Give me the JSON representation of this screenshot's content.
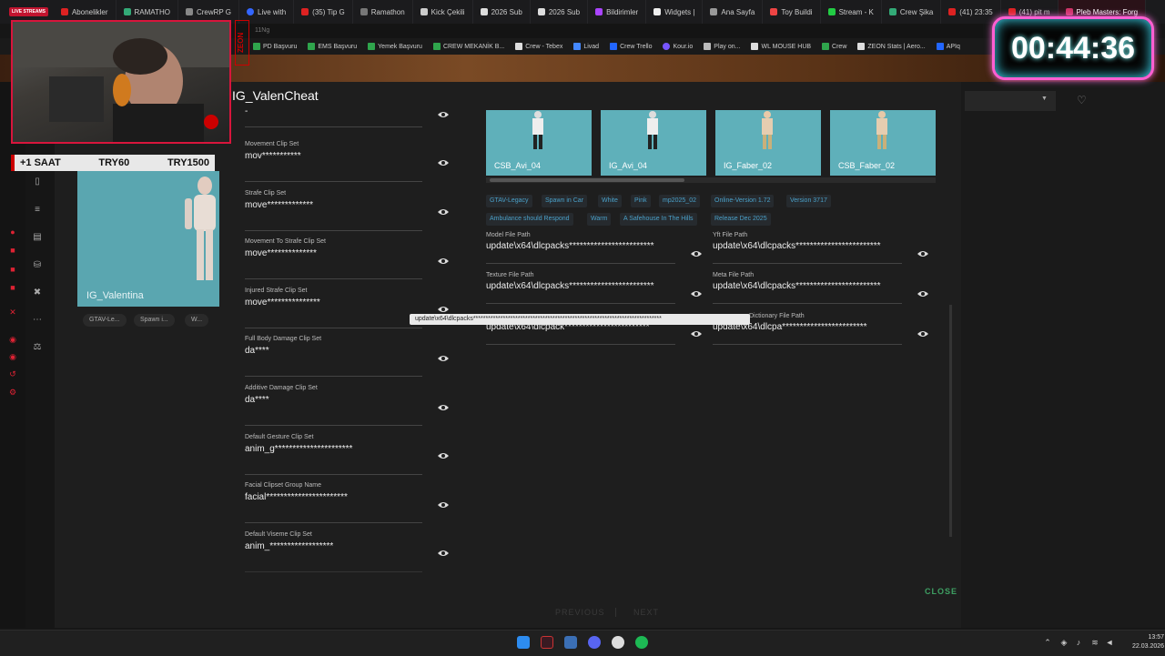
{
  "browser": {
    "tabs": [
      {
        "label": "Abonelikler"
      },
      {
        "label": "RAMATHO"
      },
      {
        "label": "CrewRP G"
      },
      {
        "label": "Live with"
      },
      {
        "label": "(35) Tip G"
      },
      {
        "label": "Ramathon"
      },
      {
        "label": "Kick Çekili"
      },
      {
        "label": "2026 Sub"
      },
      {
        "label": "2026 Sub"
      },
      {
        "label": "Bildirimler"
      },
      {
        "label": "Widgets |"
      },
      {
        "label": "Ana Sayfa"
      },
      {
        "label": "Toy Buildi"
      },
      {
        "label": "Stream - K"
      },
      {
        "label": "Crew Şika"
      },
      {
        "label": "(41) 23:35"
      },
      {
        "label": "(41) pit m"
      },
      {
        "label": "Pleb Masters: Forg"
      }
    ],
    "live_badge": "LIVE STREAMS",
    "url_fragment": "11Ng",
    "bookmarks": [
      "PD Başvuru",
      "EMS Başvuru",
      "Yemek Başvuru",
      "CREW MEKANİK B...",
      "Crew - Tebex",
      "Livad",
      "Crew Trello",
      "Kour.io",
      "Play on...",
      "WL MOUSE HUB",
      "Crew",
      "ZEON Stats | Aero...",
      "APIq"
    ]
  },
  "overlay": {
    "timer": "00:44:36",
    "ticker": {
      "a": "+1 SAAT",
      "b": "TRY60",
      "c": "TRY1500"
    },
    "zeon": "ZEON"
  },
  "character_card": {
    "name": "IG_Valentina",
    "chips": [
      "GTAV-Le...",
      "Spawn i...",
      "W..."
    ]
  },
  "detail": {
    "title": "IG_ValenCheat",
    "top_value": "-",
    "fields": [
      {
        "label": "Movement Clip Set",
        "value": "mov***********"
      },
      {
        "label": "Strafe Clip Set",
        "value": "move*************"
      },
      {
        "label": "Movement To Strafe Clip Set",
        "value": "move**************"
      },
      {
        "label": "Injured Strafe Clip Set",
        "value": "move***************"
      },
      {
        "label": "Full Body Damage Clip Set",
        "value": "da****"
      },
      {
        "label": "Additive Damage Clip Set",
        "value": "da****"
      },
      {
        "label": "Default Gesture Clip Set",
        "value": "anim_g**********************"
      },
      {
        "label": "Facial Clipset Group Name",
        "value": "facial***********************"
      },
      {
        "label": "Default Viseme Clip Set",
        "value": "anim_******************"
      }
    ],
    "thumbnails": [
      "CSB_Avi_04",
      "IG_Avi_04",
      "IG_Faber_02",
      "CSB_Faber_02"
    ],
    "tags": [
      "GTAV-Legacy",
      "Spawn in Car",
      "White",
      "Pink",
      "mp2025_02",
      "Online-Version 1.72",
      "Version 3717",
      "Ambulance should Respond",
      "Warm",
      "A Safehouse In The Hills",
      "Release Dec 2025"
    ],
    "paths": [
      {
        "label": "Model File Path",
        "value": "update\\x64\\dlcpacks************************"
      },
      {
        "label": "Yft File Path",
        "value": "update\\x64\\dlcpacks************************"
      },
      {
        "label": "Texture File Path",
        "value": "update\\x64\\dlcpacks************************"
      },
      {
        "label": "Meta File Path",
        "value": "update\\x64\\dlcpacks************************"
      },
      {
        "label": "",
        "value": "update\\x64\\dlcpack************************"
      },
      {
        "label": "Dictionary File Path",
        "value": "update\\x64\\dlcpa************************"
      }
    ],
    "tooltip": "update\\x64\\dlcpacks****************************************************************************",
    "close_label": "CLOSE",
    "prev_label": "PREVIOUS",
    "next_label": "NEXT"
  },
  "taskbar": {
    "time": "13:57",
    "date": "22.03.2026"
  },
  "colors": {
    "accent": "#3ea063",
    "tag_text": "#4aa0c8",
    "card_bg": "#5aa6b0",
    "timer_border": "#ff5fd2"
  }
}
